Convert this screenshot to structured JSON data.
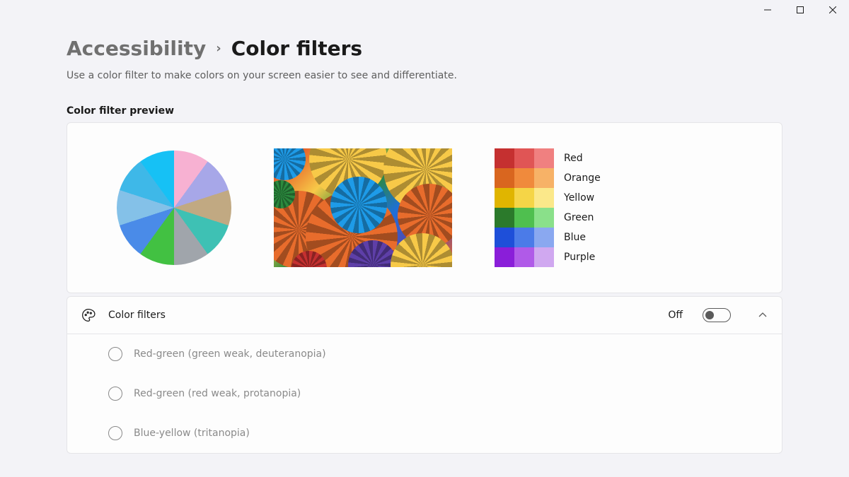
{
  "breadcrumb": {
    "parent": "Accessibility",
    "current": "Color filters"
  },
  "description": "Use a color filter to make colors on your screen easier to see and differentiate.",
  "preview": {
    "label": "Color filter preview",
    "swatches": [
      {
        "name": "Red",
        "shades": [
          "#c53030",
          "#e05555",
          "#f08080"
        ]
      },
      {
        "name": "Orange",
        "shades": [
          "#d9661f",
          "#f08a3c",
          "#f7b267"
        ]
      },
      {
        "name": "Yellow",
        "shades": [
          "#e0b500",
          "#f5d547",
          "#fbe88a"
        ]
      },
      {
        "name": "Green",
        "shades": [
          "#2b7a2b",
          "#4fbf4f",
          "#8ae08a"
        ]
      },
      {
        "name": "Blue",
        "shades": [
          "#1e4fd9",
          "#4b7be8",
          "#8aa8f0"
        ]
      },
      {
        "name": "Purple",
        "shades": [
          "#8a1ed9",
          "#b05ae8",
          "#d0a8f0"
        ]
      }
    ]
  },
  "setting": {
    "title": "Color filters",
    "state_label": "Off",
    "options": [
      "Red-green (green weak, deuteranopia)",
      "Red-green (red weak, protanopia)",
      "Blue-yellow (tritanopia)"
    ]
  }
}
